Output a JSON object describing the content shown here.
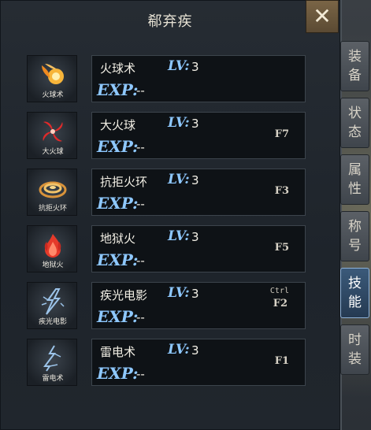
{
  "window": {
    "title": "郗弃疾",
    "close_label": "✕"
  },
  "skills": [
    {
      "name": "火球术",
      "lv_label": "LV:",
      "level": "3",
      "exp_label": "EXP:",
      "exp": "--",
      "hotkey": "",
      "modifier": "",
      "icon_label": "火球术",
      "icon": "fireball-icon",
      "color": "#f0a030"
    },
    {
      "name": "大火球",
      "lv_label": "LV:",
      "level": "3",
      "exp_label": "EXP:",
      "exp": "--",
      "hotkey": "F7",
      "modifier": "",
      "icon_label": "大火球",
      "icon": "big-fireball-icon",
      "color": "#e02a2a"
    },
    {
      "name": "抗拒火环",
      "lv_label": "LV:",
      "level": "3",
      "exp_label": "EXP:",
      "exp": "--",
      "hotkey": "F3",
      "modifier": "",
      "icon_label": "抗拒火环",
      "icon": "fire-ring-icon",
      "color": "#e3a84a"
    },
    {
      "name": "地狱火",
      "lv_label": "LV:",
      "level": "3",
      "exp_label": "EXP:",
      "exp": "--",
      "hotkey": "F5",
      "modifier": "",
      "icon_label": "地狱火",
      "icon": "hellfire-icon",
      "color": "#e53a2a"
    },
    {
      "name": "疾光电影",
      "lv_label": "LV:",
      "level": "3",
      "exp_label": "EXP:",
      "exp": "--",
      "hotkey": "F2",
      "modifier": "Ctrl",
      "icon_label": "疾光电影",
      "icon": "lightning-bolt-icon",
      "color": "#8fb9e0"
    },
    {
      "name": "雷电术",
      "lv_label": "LV:",
      "level": "3",
      "exp_label": "EXP:",
      "exp": "--",
      "hotkey": "F1",
      "modifier": "",
      "icon_label": "雷电术",
      "icon": "thunder-icon",
      "color": "#8fb9e0"
    }
  ],
  "tabs": [
    {
      "label": "装备",
      "active": false
    },
    {
      "label": "状态",
      "active": false
    },
    {
      "label": "属性",
      "active": false
    },
    {
      "label": "称号",
      "active": false
    },
    {
      "label": "技能",
      "active": true
    },
    {
      "label": "时装",
      "active": false
    }
  ]
}
